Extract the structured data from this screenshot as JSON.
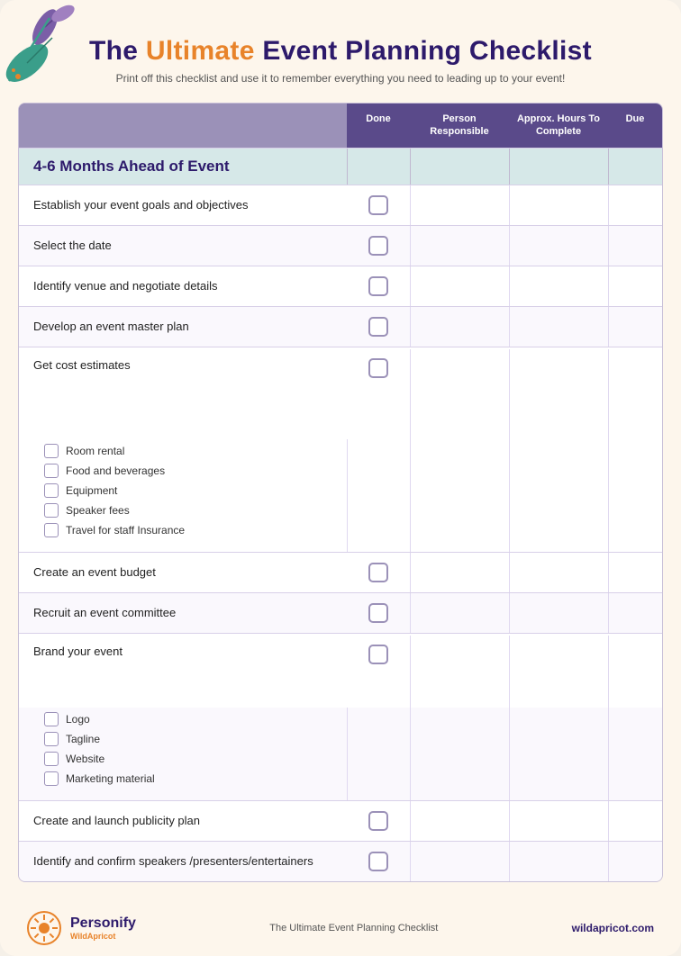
{
  "header": {
    "title_pre": "The ",
    "title_highlight": "Ultimate",
    "title_post": " Event  Planning Checklist",
    "subtitle": "Print off this checklist and use it to remember everything you need to leading up to your event!"
  },
  "table": {
    "columns": {
      "task": "",
      "done": "Done",
      "person": "Person Responsible",
      "hours": "Approx. Hours To Complete",
      "due": "Due"
    },
    "section": "4-6 Months Ahead of Event",
    "rows": [
      {
        "id": 1,
        "task": "Establish your event goals and objectives",
        "subtasks": []
      },
      {
        "id": 2,
        "task": "Select the date",
        "subtasks": []
      },
      {
        "id": 3,
        "task": "Identify venue and negotiate details",
        "subtasks": []
      },
      {
        "id": 4,
        "task": "Develop an event master plan",
        "subtasks": []
      },
      {
        "id": 5,
        "task": "Get cost estimates",
        "subtasks": [
          "Room rental",
          "Food and beverages",
          "Equipment",
          "Speaker fees",
          "Travel for staff Insurance"
        ]
      },
      {
        "id": 6,
        "task": "Create an event budget",
        "subtasks": []
      },
      {
        "id": 7,
        "task": "Recruit an event committee",
        "subtasks": []
      },
      {
        "id": 8,
        "task": "Brand your event",
        "subtasks": [
          "Logo",
          "Tagline",
          "Website",
          "Marketing material"
        ]
      },
      {
        "id": 9,
        "task": "Create and launch publicity plan",
        "subtasks": []
      },
      {
        "id": 10,
        "task": "Identify and confirm speakers /presenters/entertainers",
        "subtasks": []
      }
    ]
  },
  "footer": {
    "brand_name": "Personify",
    "brand_sub": "WildApricot",
    "doc_title": "The Ultimate Event  Planning Checklist",
    "url": "wildapricot.com"
  }
}
